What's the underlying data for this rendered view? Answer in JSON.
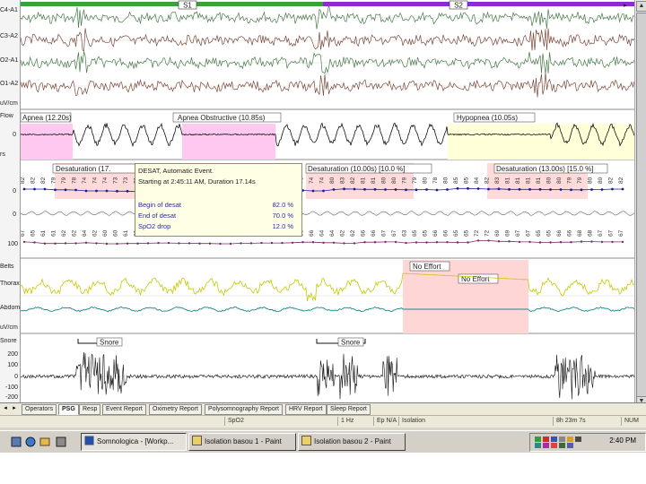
{
  "channels": {
    "eeg": [
      "C4-A1",
      "C3-A2",
      "O2-A1",
      "O1-A2"
    ],
    "flow_top": "uV/cm",
    "flow": "Flow",
    "flow_tick": "0",
    "effort_unit": "rs",
    "spo2_tick": "0",
    "pulse_tick": "0",
    "tick_100": "100",
    "belts": "Belts",
    "thorax": "Thorax",
    "abdomen": "Abdomen",
    "belts_unit": "uV/cm",
    "snore": "Snore",
    "snore_ticks": [
      "200",
      "100",
      "0",
      "-100",
      "-200"
    ]
  },
  "stages": [
    "S1",
    "S2"
  ],
  "events": {
    "flow": [
      "Apnea (12.20s)",
      "Apnea Obstructive (10.85s)",
      "Hypopnea (10.05s)"
    ],
    "desat": [
      "Desaturation (17.",
      "Desaturation (10.00s) [10.0 %]",
      "Desaturation (13.00s) [15.0 %]"
    ],
    "no_effort": [
      "No Effort",
      "No Effort"
    ],
    "snore": [
      "Snore",
      "Snore"
    ]
  },
  "popup": {
    "line1": "DESAT, Automatic Event.",
    "line2": "Starting at 2:45:11 AM, Duration 17.14s",
    "rows": [
      {
        "label": "Begin of desat",
        "value": "82.0 %"
      },
      {
        "label": "End of desat",
        "value": "70.0 %"
      },
      {
        "label": "SpO2 drop",
        "value": "12.0 %"
      }
    ]
  },
  "spo2_values": [
    "82",
    "82",
    "82",
    "79",
    "79",
    "78",
    "74",
    "74",
    "74",
    "73",
    "73",
    "71",
    "71",
    "70",
    "70",
    "80",
    "84",
    "85",
    "88",
    "88",
    "87",
    "81",
    "81",
    "79",
    "79",
    "78",
    "76",
    "76",
    "74",
    "74",
    "80",
    "83",
    "82",
    "81",
    "81",
    "80",
    "80",
    "79",
    "79",
    "80",
    "78",
    "80",
    "85",
    "85",
    "84",
    "82",
    "83",
    "81",
    "81",
    "81",
    "81",
    "80",
    "80",
    "79",
    "79",
    "80",
    "80",
    "82",
    "82"
  ],
  "pulse_values": [
    "67",
    "65",
    "61",
    "61",
    "62",
    "62",
    "64",
    "62",
    "60",
    "60",
    "61",
    "61",
    "62",
    "63",
    "63",
    "62",
    "62",
    "61",
    "61",
    "60",
    "60",
    "62",
    "62",
    "63",
    "63",
    "63",
    "64",
    "66",
    "66",
    "64",
    "64",
    "62",
    "62",
    "66",
    "66",
    "67",
    "67",
    "63",
    "65",
    "65",
    "66",
    "66",
    "65",
    "65",
    "72",
    "72",
    "69",
    "69",
    "67",
    "67",
    "65",
    "65",
    "66",
    "66",
    "68",
    "68",
    "67",
    "67",
    "67"
  ],
  "tabs": [
    "Operators",
    "PSG",
    "Resp",
    "Event Report",
    "Oximetry Report",
    "Polysomnography Report",
    "HRV Report",
    "Sleep Report"
  ],
  "active_tab": "PSG",
  "status": [
    "SpO2",
    "1 Hz",
    "Ep  N/A",
    "Isolation",
    "8h 23m 7s",
    "NUM"
  ],
  "taskbar": {
    "tasks": [
      "Somnologica - [Workp...",
      "Isolation basou 1 - Paint",
      "Isolation basou 2 - Paint"
    ],
    "clock": "2:40 PM"
  },
  "colors": {
    "apnea": "#ffc8f0",
    "hypopnea": "#ffffd8",
    "desat": "#ffdada",
    "no_effort": "#ffd6d6",
    "eeg_trace": "#4a7a4a",
    "eeg_trace2": "#7a4a3a",
    "stage_bar_1": "#3aa23a",
    "stage_bar_2": "#8a2ad8",
    "spo2_line": "#1a1a9a",
    "thorax": "#c8c800",
    "abdomen": "#1a8a8a"
  }
}
